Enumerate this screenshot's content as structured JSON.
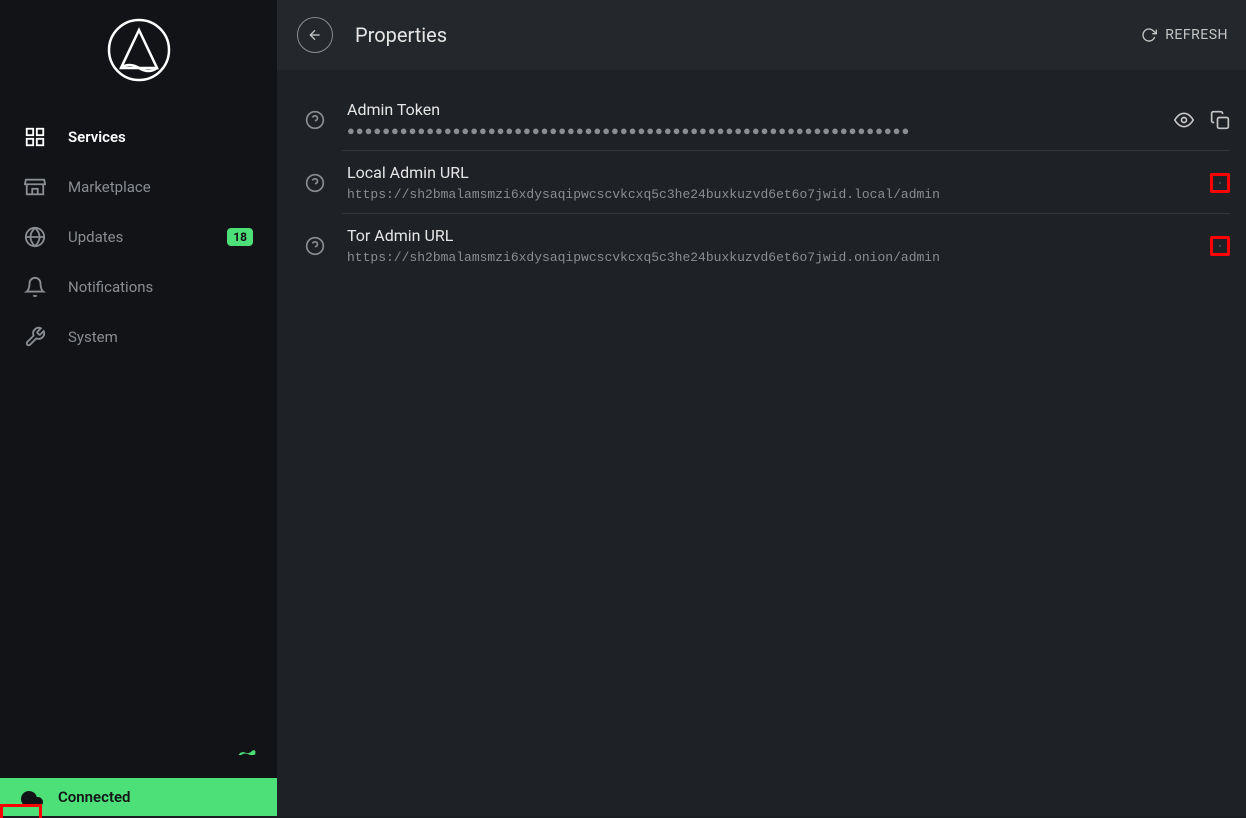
{
  "sidebar": {
    "items": [
      {
        "label": "Services",
        "icon": "grid-icon",
        "active": true
      },
      {
        "label": "Marketplace",
        "icon": "store-icon",
        "active": false
      },
      {
        "label": "Updates",
        "icon": "globe-icon",
        "active": false,
        "badge": "18"
      },
      {
        "label": "Notifications",
        "icon": "bell-icon",
        "active": false
      },
      {
        "label": "System",
        "icon": "tools-icon",
        "active": false
      }
    ],
    "status": "Connected"
  },
  "header": {
    "title": "Properties",
    "refresh_label": "REFRESH"
  },
  "properties": [
    {
      "title": "Admin Token",
      "value": "●●●●●●●●●●●●●●●●●●●●●●●●●●●●●●●●●●●●●●●●●●●●●●●●●●●●●●●●●●●●●●●●",
      "masked": true,
      "show_eye": true,
      "highlight_copy": false
    },
    {
      "title": "Local Admin URL",
      "value": "https://sh2bmalamsmzi6xdysaqipwcscvkcxq5c3he24buxkuzvd6et6o7jwid.local/admin",
      "masked": false,
      "show_eye": false,
      "highlight_copy": true
    },
    {
      "title": "Tor Admin URL",
      "value": "https://sh2bmalamsmzi6xdysaqipwcscvkcxq5c3he24buxkuzvd6et6o7jwid.onion/admin",
      "masked": false,
      "show_eye": false,
      "highlight_copy": true
    }
  ]
}
